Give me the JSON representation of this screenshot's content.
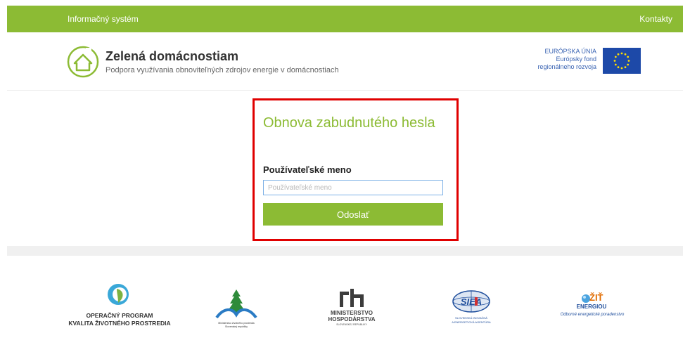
{
  "topbar": {
    "title": "Informačný systém",
    "contacts": "Kontakty"
  },
  "brand": {
    "title": "Zelená domácnostiam",
    "subtitle": "Podpora využívania obnoviteľných zdrojov energie v domácnostiach"
  },
  "eu": {
    "line1": "EURÓPSKA ÚNIA",
    "line2": "Európsky fond",
    "line3": "regionálneho rozvoja"
  },
  "form": {
    "title": "Obnova zabudnutého hesla",
    "label": "Používateľské meno",
    "placeholder": "Používateľské meno",
    "submit": "Odoslať"
  },
  "partners": {
    "op": {
      "line1": "OPERAČNÝ PROGRAM",
      "line2": "KVALITA ŽIVOTNÉHO PROSTREDIA"
    },
    "ministry_env": {
      "line1": "Ministerstvo životného prostredia",
      "line2": "Slovenskej republiky"
    },
    "mh": {
      "line1": "MINISTERSTVO",
      "line2": "HOSPODÁRSTVA",
      "line3": "SLOVENSKEJ REPUBLIKY"
    },
    "siea": {
      "line1": "SLOVENSKÁ INOVAČNÁ",
      "line2": "A ENERGETICKÁ AGENTÚRA"
    },
    "zit": {
      "line1": "ŽIŤ",
      "line2": "ENERGIOU",
      "line3": "Odborné energetické poradenstvo"
    }
  },
  "colors": {
    "brand_green": "#8cbb34",
    "highlight_red": "#e00000",
    "eu_blue": "#1d49a8",
    "eu_star": "#ffdd00"
  }
}
